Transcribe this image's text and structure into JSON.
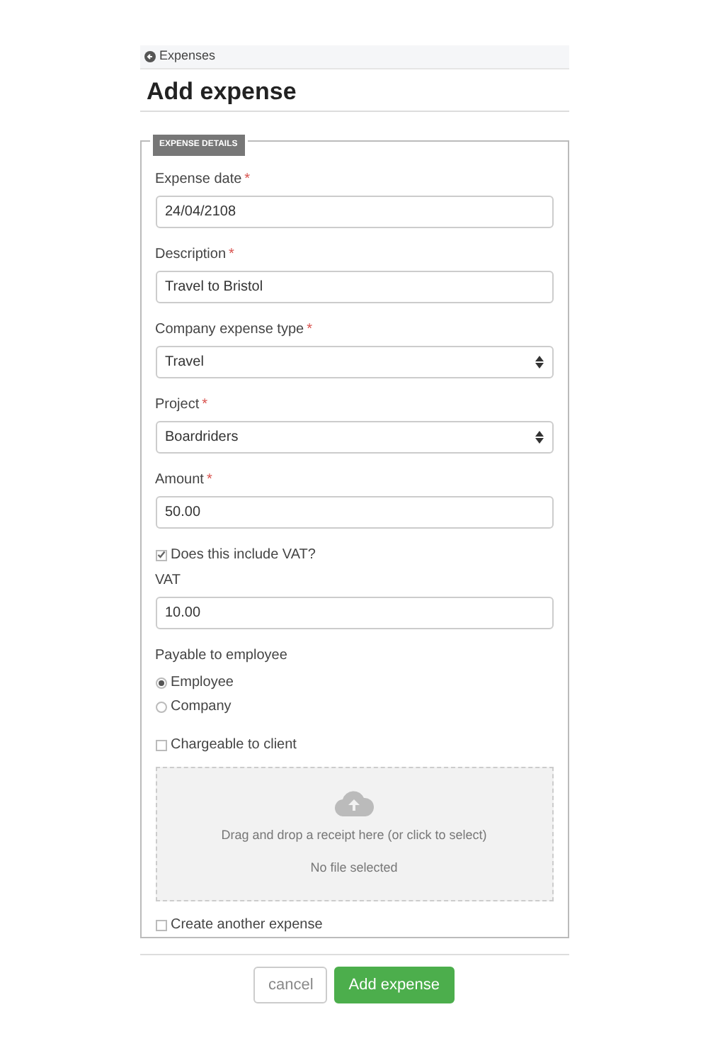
{
  "breadcrumb": {
    "label": "Expenses"
  },
  "title": "Add expense",
  "fieldset": {
    "legend": "EXPENSE DETAILS",
    "items": [
      {
        "kind": "text",
        "label": "Expense date",
        "required_mark": "*",
        "value": "24/04/2108"
      },
      {
        "kind": "text",
        "label": "Description",
        "required_mark": "*",
        "value": "Travel to Bristol"
      },
      {
        "kind": "select",
        "label": "Company expense type",
        "required_mark": "*",
        "value": "Travel"
      },
      {
        "kind": "select",
        "label": "Project",
        "required_mark": "*",
        "value": "Boardriders"
      },
      {
        "kind": "text",
        "label": "Amount",
        "required_mark": "*",
        "value": "50.00"
      },
      {
        "kind": "checkbox",
        "label": "Does this include VAT?",
        "checked": true
      },
      {
        "kind": "text",
        "label": "VAT",
        "value": "10.00"
      },
      {
        "kind": "radio_group",
        "label": "Payable to employee",
        "options": [
          {
            "label": "Employee",
            "selected": true
          },
          {
            "label": "Company",
            "selected": false
          }
        ]
      },
      {
        "kind": "checkbox",
        "label": "Chargeable to client",
        "checked": false
      },
      {
        "kind": "dropzone",
        "prompt": "Drag and drop a receipt here (or click to select)",
        "status": "No file selected"
      },
      {
        "kind": "checkbox",
        "label": "Create another expense",
        "checked": false
      }
    ]
  },
  "buttons": [
    {
      "kind": "secondary",
      "label": "cancel"
    },
    {
      "kind": "primary",
      "label": "Add expense"
    }
  ]
}
